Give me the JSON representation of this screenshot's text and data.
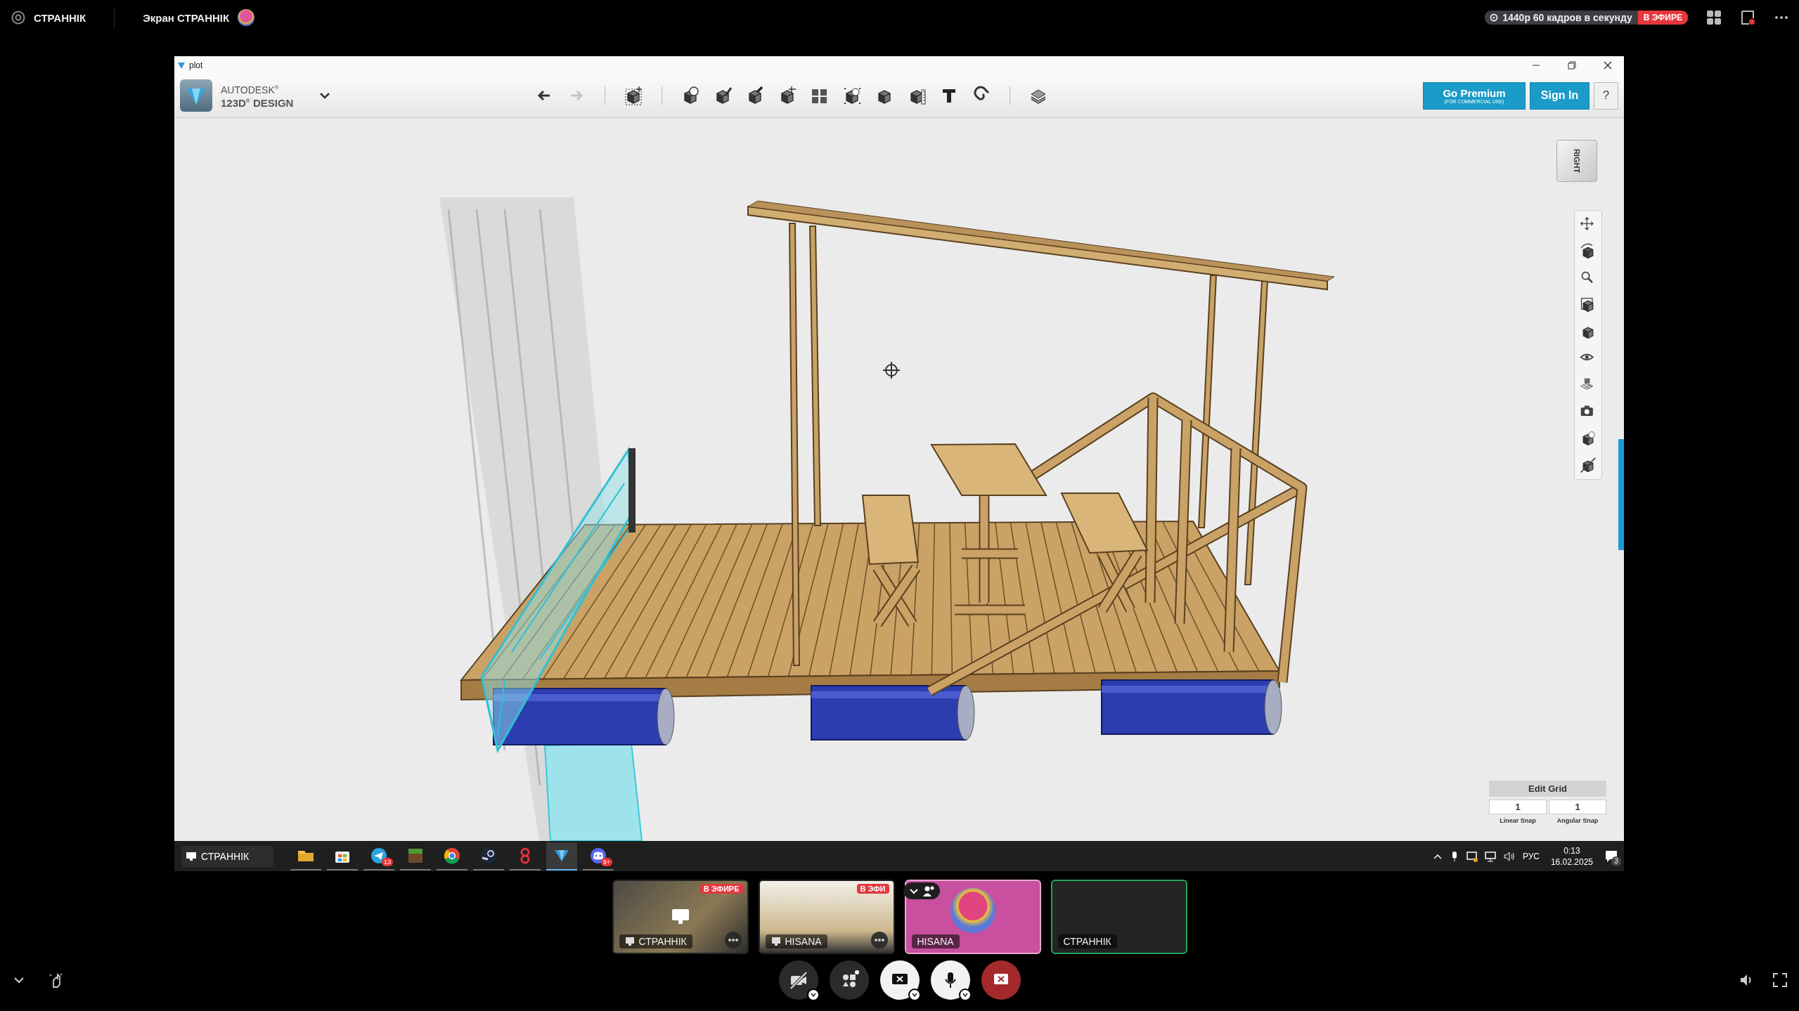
{
  "stream": {
    "user": "СТРАННІК",
    "title": "Экран СТРАННІК",
    "quality": "1440p 60 кадров в секунду",
    "live": "В ЭФИРЕ"
  },
  "window": {
    "title": "plot",
    "brand": "AUTODESK$^{®}$",
    "product": "123D$^{®}$ DESIGN",
    "history": [
      {
        "kind": "undo",
        "disabled": false
      },
      {
        "kind": "redo",
        "disabled": true
      }
    ],
    "premium": {
      "label": "Go Premium",
      "note": "(FOR COMMERCIAL USE)"
    },
    "sign_in": "Sign In",
    "help": "?",
    "view_cube": "RIGHT",
    "edit_grid": {
      "title": "Edit Grid",
      "fields": [
        {
          "value": "1",
          "label": "Linear Snap"
        },
        {
          "value": "1",
          "label": "Angular Snap"
        }
      ]
    }
  },
  "taskbar": {
    "search_label": "СТРАННІК",
    "apps": [
      {
        "kind": "explorer",
        "selected": false
      },
      {
        "kind": "store",
        "selected": false
      },
      {
        "kind": "telegram",
        "badge": "13",
        "selected": false
      },
      {
        "kind": "minecraft",
        "selected": false
      },
      {
        "kind": "chrome",
        "selected": false
      },
      {
        "kind": "steam",
        "selected": false
      },
      {
        "kind": "eight",
        "selected": false
      },
      {
        "kind": "design",
        "selected": true
      },
      {
        "kind": "discord",
        "badge": "9+",
        "selected": false
      }
    ],
    "language": "РУС",
    "time": "0:13",
    "date": "16.02.2025",
    "notifications": "3"
  },
  "participants": [
    {
      "name": "СТРАННІК",
      "kind": "screen",
      "live": "В ЭФИРЕ",
      "speaking": false
    },
    {
      "name": "HISANA",
      "kind": "screen",
      "live": "В ЭФИ",
      "speaking": false
    },
    {
      "name": "HISANA",
      "kind": "avatar",
      "speaking": false
    },
    {
      "name": "СТРАННІК",
      "kind": "camera_off",
      "speaking": true
    }
  ],
  "controls": [
    {
      "kind": "camera",
      "on": false
    },
    {
      "kind": "activities"
    },
    {
      "kind": "share"
    },
    {
      "kind": "mic",
      "on": true
    },
    {
      "kind": "end"
    }
  ]
}
